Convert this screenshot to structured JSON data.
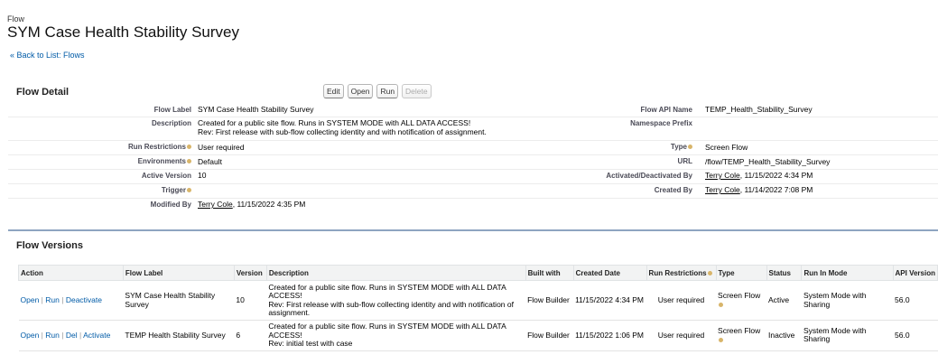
{
  "header": {
    "object_type": "Flow",
    "title": "SYM Case Health Stability Survey",
    "back_link": "« Back to List: Flows"
  },
  "detail": {
    "section_title": "Flow Detail",
    "buttons": [
      "Edit",
      "Open",
      "Run",
      "Delete"
    ],
    "left": {
      "flow_label": {
        "label": "Flow Label",
        "value": "SYM Case Health Stability Survey"
      },
      "description": {
        "label": "Description",
        "value_line1": "Created for a public site flow. Runs in SYSTEM MODE with ALL DATA ACCESS!",
        "value_line2": "Rev: First release with sub-flow collecting identity and with notification of assignment."
      },
      "run_restrictions": {
        "label": "Run Restrictions",
        "value": "User required"
      },
      "environments": {
        "label": "Environments",
        "value": "Default"
      },
      "active_version": {
        "label": "Active Version",
        "value": "10"
      },
      "trigger": {
        "label": "Trigger",
        "value": ""
      },
      "modified_by": {
        "label": "Modified By",
        "user": "Terry Cole",
        "date": ", 11/15/2022 4:35 PM"
      }
    },
    "right": {
      "api_name": {
        "label": "Flow API Name",
        "value": "TEMP_Health_Stability_Survey"
      },
      "namespace": {
        "label": "Namespace Prefix",
        "value": ""
      },
      "type": {
        "label": "Type",
        "value": "Screen Flow"
      },
      "url": {
        "label": "URL",
        "value": "/flow/TEMP_Health_Stability_Survey"
      },
      "activated_by": {
        "label": "Activated/Deactivated By",
        "user": "Terry Cole",
        "date": ", 11/15/2022 4:34 PM"
      },
      "created_by": {
        "label": "Created By",
        "user": "Terry Cole",
        "date": ", 11/14/2022 7:08 PM"
      }
    }
  },
  "versions": {
    "section_title": "Flow Versions",
    "columns": [
      "Action",
      "Flow Label",
      "Version",
      "Description",
      "Built with",
      "Created Date",
      "Run Restrictions",
      "Type",
      "Status",
      "Run In Mode",
      "API Version"
    ],
    "rows": [
      {
        "actions": [
          "Open",
          "Run",
          "Deactivate"
        ],
        "flow_label": "SYM Case Health Stability Survey",
        "version": "10",
        "description": "Created for a public site flow. Runs in SYSTEM MODE with ALL DATA ACCESS!\nRev: First release with sub-flow collecting identity and with notification of assignment.",
        "built_with": "Flow Builder",
        "created_date": "11/15/2022 4:34 PM",
        "run_restrictions": "User required",
        "type": "Screen Flow",
        "status": "Active",
        "run_mode": "System Mode with Sharing",
        "api_version": "56.0"
      },
      {
        "actions": [
          "Open",
          "Run",
          "Del",
          "Activate"
        ],
        "flow_label": "TEMP Health Stability Survey",
        "version": "6",
        "description": "Created for a public site flow. Runs in SYSTEM MODE with ALL DATA ACCESS!\nRev: initial test with case",
        "built_with": "Flow Builder",
        "created_date": "11/15/2022 1:06 PM",
        "run_restrictions": "User required",
        "type": "Screen Flow",
        "status": "Inactive",
        "run_mode": "System Mode with Sharing",
        "api_version": "56.0"
      }
    ]
  },
  "colors": {
    "link": "#015ba7",
    "section_border": "#8ea5c1",
    "help_icon": "#d8b56a"
  }
}
